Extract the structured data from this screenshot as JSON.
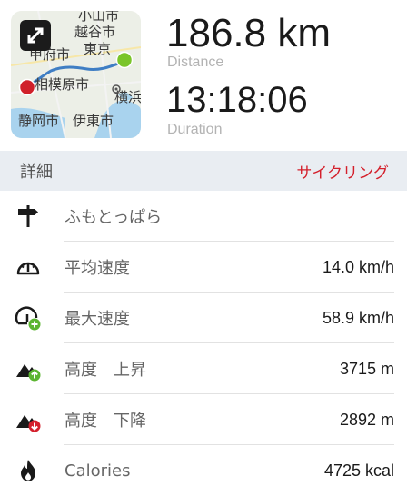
{
  "map": {
    "labels": [
      "小山市",
      "越谷市",
      "甲府市",
      "東京",
      "相模原市",
      "横浜",
      "静岡市",
      "伊東市"
    ]
  },
  "summary": {
    "distance_value": "186.8 km",
    "distance_caption": "Distance",
    "duration_value": "13:18:06",
    "duration_caption": "Duration"
  },
  "details": {
    "title": "詳細",
    "activity_type": "サイクリング",
    "accent_color": "#d4202c",
    "rows": [
      {
        "icon": "signpost-icon",
        "label": "ふもとっぱら",
        "value": ""
      },
      {
        "icon": "speedometer-icon",
        "label": "平均速度",
        "value": "14.0 km/h"
      },
      {
        "icon": "speedometer-max-icon",
        "label": "最大速度",
        "value": "58.9 km/h"
      },
      {
        "icon": "elevation-up-icon",
        "label": "高度　上昇",
        "value": "3715 m"
      },
      {
        "icon": "elevation-down-icon",
        "label": "高度　下降",
        "value": "2892 m"
      },
      {
        "icon": "flame-icon",
        "label": "Calories",
        "value": "4725 kcal"
      }
    ]
  }
}
